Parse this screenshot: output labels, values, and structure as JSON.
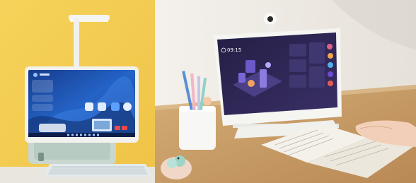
{
  "left_photo": {
    "screen_date_label": "",
    "taskbar_icons": [
      "app-icon",
      "app-icon",
      "app-icon",
      "app-icon",
      "app-icon",
      "app-icon",
      "app-icon",
      "app-icon"
    ]
  },
  "right_photo": {
    "screen_clock": "09:15",
    "brand_mark": "",
    "widget_labels": [
      "",
      "",
      ""
    ]
  },
  "colors": {
    "left_background": "#f3c94f",
    "right_background": "#ece9e3",
    "desk_wood": "#c79a63",
    "device_body": "#f2f2ef",
    "keyboard": "#e8eef0",
    "screen_left": "#1f4ea3",
    "screen_right": "#2b2450",
    "accent_purple": "#6e4bd6"
  }
}
